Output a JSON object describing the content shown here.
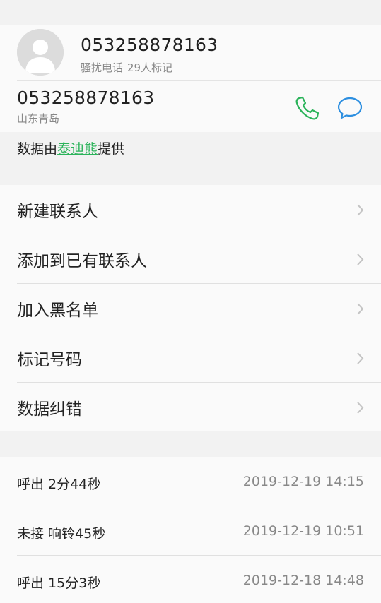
{
  "header": {
    "number": "053258878163",
    "tag": "骚扰电话",
    "mark_count": "29人标记"
  },
  "contact": {
    "number": "053258878163",
    "location": "山东青岛",
    "call_icon": "phone-icon",
    "message_icon": "message-bubble-icon"
  },
  "provider": {
    "prefix": "数据由",
    "name": "泰迪熊",
    "suffix": "提供"
  },
  "menu": {
    "items": [
      {
        "label": "新建联系人"
      },
      {
        "label": "添加到已有联系人"
      },
      {
        "label": "加入黑名单"
      },
      {
        "label": "标记号码"
      },
      {
        "label": "数据纠错"
      }
    ]
  },
  "call_log": [
    {
      "type": "呼出 2分44秒",
      "time": "2019-12-19 14:15"
    },
    {
      "type": "未接 响铃45秒",
      "time": "2019-12-19 10:51"
    },
    {
      "type": "呼出 15分3秒",
      "time": "2019-12-18 14:48"
    }
  ],
  "colors": {
    "call": "#2bb35a",
    "message": "#2d8fe0",
    "link": "#2bb35a"
  }
}
